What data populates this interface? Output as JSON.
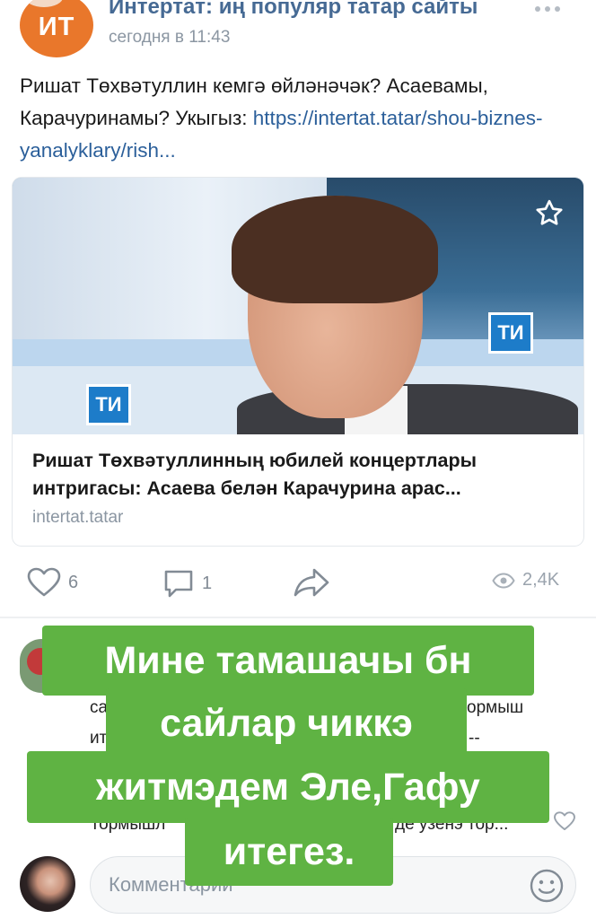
{
  "post": {
    "group_name": "Интертат: иң популяр татар сайты",
    "time": "сегодня в 11:43",
    "avatar_text": "ИТ",
    "text_before_link": "Ришат Төхвәтуллин кемгә өйләнәчәк? Асаевамы, Карачуринамы? Укыгыз: ",
    "link_text": "https://intertat.tatar/shou-biznes-yanalyklary/rish..."
  },
  "card": {
    "title": "Ришат Төхвәтуллинның юбилей концертлары интригасы: Асаева белән Карачурина арас...",
    "domain": "intertat.tatar",
    "image_logo_text": "ТИ"
  },
  "actions": {
    "likes": "6",
    "comments": "1",
    "views": "2,4K"
  },
  "comment": {
    "fragment_1": "са",
    "fragment_2": "ормыш",
    "fragment_3": "ит",
    "fragment_4": "--",
    "fragment_5": "Тормышл",
    "fragment_6": "де узенэ тор..."
  },
  "comment_input": {
    "placeholder": "Комментарий"
  },
  "overlay": {
    "line_1": "Мине тамашачы бн",
    "line_2": "сайлар чиккэ",
    "line_3": "житмэдем Эле,Гафу",
    "line_4": "итегез."
  },
  "colors": {
    "overlay_bg": "#5fb343",
    "accent_link": "#2b5f9a",
    "group_name": "#466a94",
    "avatar_orange": "#e9772b"
  },
  "icons": [
    "more-icon",
    "favorite-star-icon",
    "heart-icon",
    "comment-icon",
    "share-icon",
    "eye-icon",
    "smile-icon"
  ]
}
